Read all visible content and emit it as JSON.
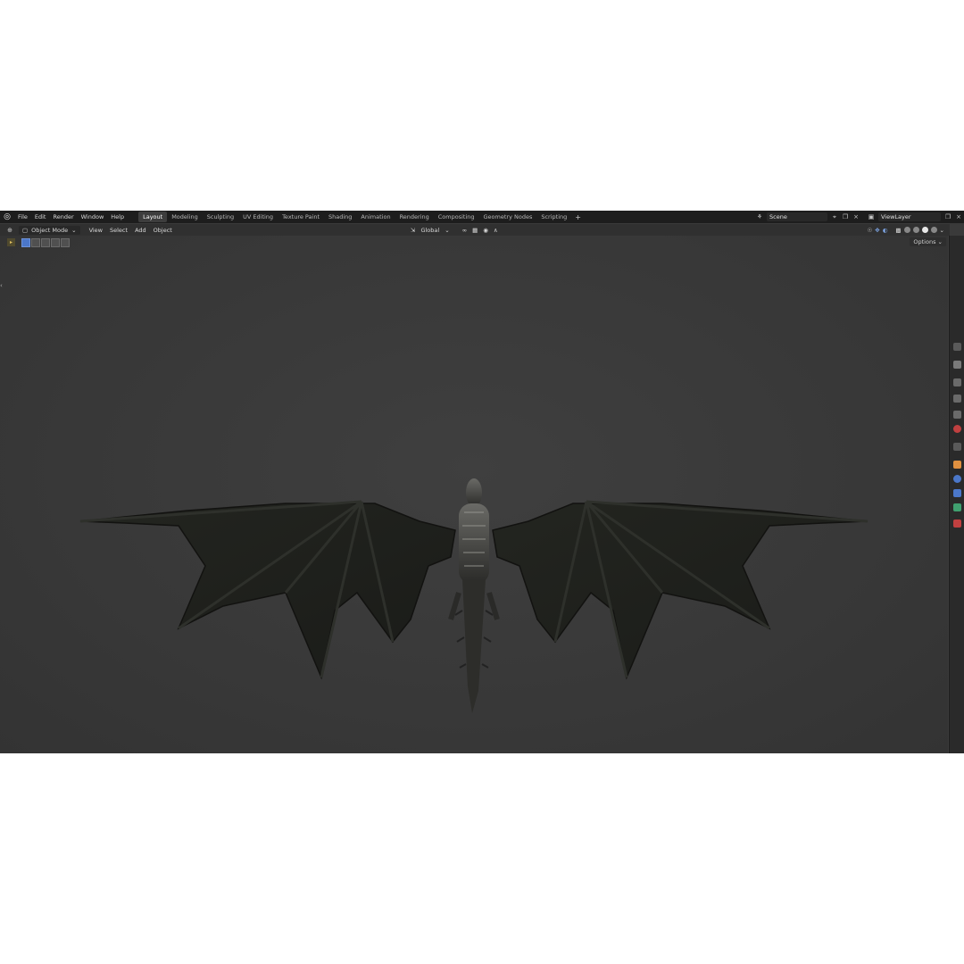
{
  "topbar": {
    "menus": [
      "File",
      "Edit",
      "Render",
      "Window",
      "Help"
    ],
    "workspaces": [
      "Layout",
      "Modeling",
      "Sculpting",
      "UV Editing",
      "Texture Paint",
      "Shading",
      "Animation",
      "Rendering",
      "Compositing",
      "Geometry Nodes",
      "Scripting"
    ],
    "active_workspace": "Layout",
    "add_label": "+",
    "scene": "Scene",
    "view_layer": "ViewLayer"
  },
  "header": {
    "mode": "Object Mode",
    "menus": [
      "View",
      "Select",
      "Add",
      "Object"
    ],
    "orientation": "Global"
  },
  "toolrow": {
    "options": "Options"
  },
  "colors": {
    "accent": "#4b77c9",
    "topbar_bg": "#1d1d1d",
    "viewport_bg": "#3a3a3a"
  },
  "icons": [
    "blender-logo-icon",
    "editor-type-icon",
    "object-mode-icon",
    "transform-orientation-icon",
    "snap-icon",
    "proportional-edit-icon",
    "viewport-shading-icon",
    "properties-tool-icon",
    "render-properties-icon",
    "output-properties-icon",
    "view-layer-icon",
    "scene-icon",
    "world-icon",
    "object-icon",
    "modifier-icon",
    "physics-icon",
    "constraint-icon",
    "data-icon",
    "material-icon"
  ]
}
